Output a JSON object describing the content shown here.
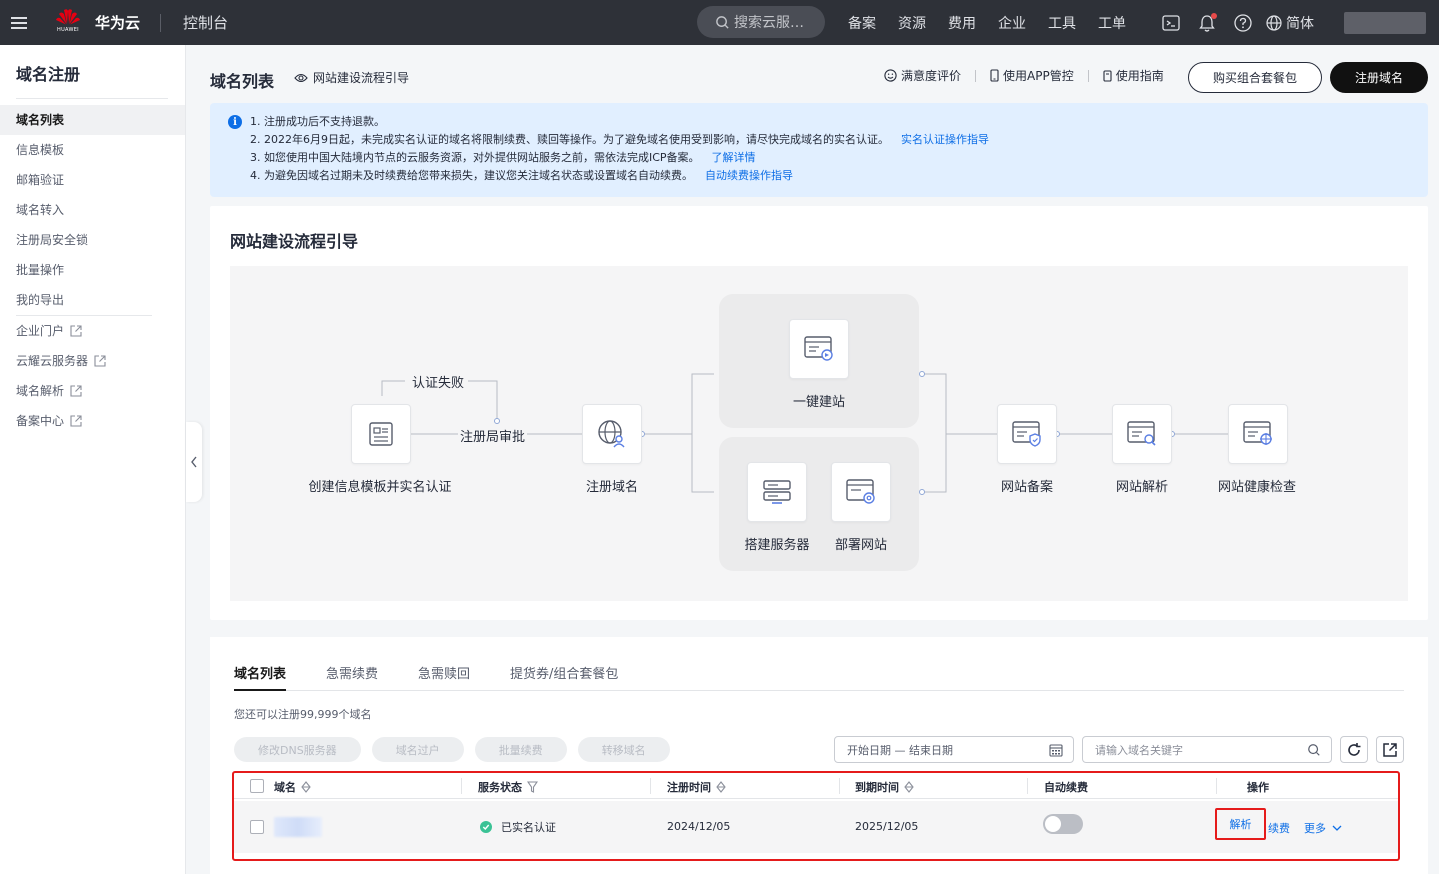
{
  "topbar": {
    "brand_sub": "HUAWEI",
    "brand_name": "华为云",
    "console": "控制台",
    "search_placeholder": "搜索云服…",
    "nav": [
      "备案",
      "资源",
      "费用",
      "企业",
      "工具",
      "工单"
    ],
    "lang": "简体"
  },
  "sidebar": {
    "title": "域名注册",
    "items": [
      {
        "label": "域名列表",
        "active": true
      },
      {
        "label": "信息模板"
      },
      {
        "label": "邮箱验证"
      },
      {
        "label": "域名转入"
      },
      {
        "label": "注册局安全锁"
      },
      {
        "label": "批量操作"
      },
      {
        "label": "我的导出"
      }
    ],
    "external": [
      "企业门户",
      "云耀云服务器",
      "域名解析",
      "备案中心"
    ]
  },
  "header": {
    "title": "域名列表",
    "guide": "网站建设流程引导",
    "feedback": "满意度评价",
    "app": "使用APP管控",
    "manual": "使用指南",
    "buy_package": "购买组合套餐包",
    "register": "注册域名"
  },
  "notice": {
    "lines": [
      {
        "text": "1. 注册成功后不支持退款。",
        "link": ""
      },
      {
        "text": "2. 2022年6月9日起，未完成实名认证的域名将限制续费、赎回等操作。为了避免域名使用受到影响，请尽快完成域名的实名认证。",
        "link": "实名认证操作指导"
      },
      {
        "text": "3. 如您使用中国大陆境内节点的云服务资源，对外提供网站服务之前，需依法完成ICP备案。",
        "link": "了解详情"
      },
      {
        "text": "4. 为避免因域名过期未及时续费给您带来损失，建议您关注域名状态或设置域名自动续费。",
        "link": "自动续费操作指导"
      }
    ]
  },
  "guide": {
    "title": "网站建设流程引导",
    "fail_label": "认证失败",
    "review_label": "注册局审批",
    "steps": {
      "template": "创建信息模板并实名认证",
      "register": "注册域名",
      "one_click": "一键建站",
      "server": "搭建服务器",
      "deploy": "部署网站",
      "icp": "网站备案",
      "dns": "网站解析",
      "health": "网站健康检查"
    }
  },
  "list": {
    "tabs": [
      "域名列表",
      "急需续费",
      "急需赎回",
      "提货券/组合套餐包"
    ],
    "quota": "您还可以注册99,999个域名",
    "toolbar": [
      "修改DNS服务器",
      "域名过户",
      "批量续费",
      "转移域名"
    ],
    "date_placeholder": "开始日期 — 结束日期",
    "keyword_placeholder": "请输入域名关键字",
    "columns": {
      "domain": "域名",
      "status": "服务状态",
      "reg_time": "注册时间",
      "exp_time": "到期时间",
      "auto_renew": "自动续费",
      "ops": "操作"
    },
    "rows": [
      {
        "status": "已实名认证",
        "reg_time": "2024/12/05",
        "exp_time": "2025/12/05",
        "auto_renew": false,
        "ops": {
          "resolve": "解析",
          "renew": "续费",
          "more": "更多"
        }
      }
    ]
  },
  "colors": {
    "topbar": "#2e3138",
    "link": "#0d6ee6",
    "highlight": "#e51b1b",
    "success": "#3ac295",
    "notice_bg": "#e1efff"
  }
}
